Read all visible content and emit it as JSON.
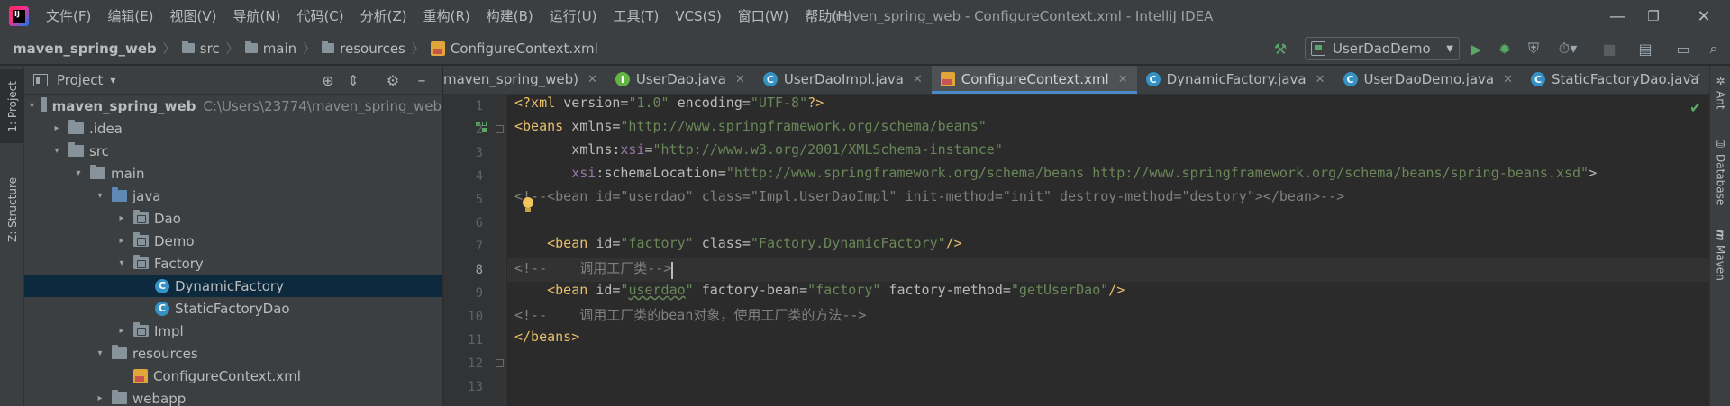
{
  "window": {
    "title": "maven_spring_web - ConfigureContext.xml - IntelliJ IDEA",
    "logo_text": "IJ",
    "controls": [
      "—",
      "❐",
      "✕"
    ]
  },
  "menu": [
    "文件(F)",
    "编辑(E)",
    "视图(V)",
    "导航(N)",
    "代码(C)",
    "分析(Z)",
    "重构(R)",
    "构建(B)",
    "运行(U)",
    "工具(T)",
    "VCS(S)",
    "窗口(W)",
    "帮助(H)"
  ],
  "breadcrumbs": [
    "maven_spring_web",
    "src",
    "main",
    "resources",
    "ConfigureContext.xml"
  ],
  "toolbar": {
    "run_config": "UserDaoDemo",
    "icons": [
      "hammer-icon",
      "run-icon",
      "debug-icon",
      "coverage-icon",
      "profile-icon",
      "stop-icon",
      "project-structure-icon",
      "layout-icon",
      "search-icon"
    ]
  },
  "left_strip": {
    "project_tab": "1: Project",
    "structure_tab": "Z: Structure"
  },
  "project_panel": {
    "title": "Project",
    "caret": "▾",
    "tree": [
      {
        "label": "maven_spring_web",
        "path": "C:\\Users\\23774\\maven_spring_web",
        "icon": "folder",
        "arrow": "▾",
        "depth": 0,
        "bold": true
      },
      {
        "label": ".idea",
        "icon": "folder",
        "arrow": "▸",
        "depth": 1
      },
      {
        "label": "src",
        "icon": "folder",
        "arrow": "▾",
        "depth": 1
      },
      {
        "label": "main",
        "icon": "folder",
        "arrow": "▾",
        "depth": 2
      },
      {
        "label": "java",
        "icon": "folder-blue",
        "arrow": "▾",
        "depth": 3
      },
      {
        "label": "Dao",
        "icon": "package",
        "arrow": "▸",
        "depth": 4
      },
      {
        "label": "Demo",
        "icon": "package",
        "arrow": "▸",
        "depth": 4
      },
      {
        "label": "Factory",
        "icon": "package",
        "arrow": "▾",
        "depth": 4
      },
      {
        "label": "DynamicFactory",
        "icon": "class",
        "arrow": "",
        "depth": 5,
        "selected": true
      },
      {
        "label": "StaticFactoryDao",
        "icon": "class",
        "arrow": "",
        "depth": 5
      },
      {
        "label": "Impl",
        "icon": "package",
        "arrow": "▸",
        "depth": 4
      },
      {
        "label": "resources",
        "icon": "folder-res",
        "arrow": "▾",
        "depth": 3
      },
      {
        "label": "ConfigureContext.xml",
        "icon": "xml",
        "arrow": "",
        "depth": 4
      },
      {
        "label": "webapp",
        "icon": "folder",
        "arrow": "▸",
        "depth": 3
      }
    ]
  },
  "tabs": [
    {
      "label": "maven_spring_web)",
      "icon": "none"
    },
    {
      "label": "UserDao.java",
      "icon": "interface"
    },
    {
      "label": "UserDaoImpl.java",
      "icon": "class"
    },
    {
      "label": "ConfigureContext.xml",
      "icon": "xml",
      "active": true
    },
    {
      "label": "DynamicFactory.java",
      "icon": "class"
    },
    {
      "label": "UserDaoDemo.java",
      "icon": "class"
    },
    {
      "label": "StaticFactoryDao.java",
      "icon": "class"
    }
  ],
  "editor": {
    "current_line": 8,
    "lines": [
      {
        "n": "1",
        "tokens": [
          [
            "t-pi",
            "<?xml "
          ],
          [
            "t-attr",
            "version="
          ],
          [
            "t-val",
            "\"1.0\""
          ],
          [
            "t-attr",
            " encoding="
          ],
          [
            "t-val",
            "\"UTF-8\""
          ],
          [
            "t-pi",
            "?>"
          ]
        ]
      },
      {
        "n": "2",
        "tokens": [
          [
            "t-tag",
            "<beans "
          ],
          [
            "t-attr",
            "xmlns="
          ],
          [
            "t-val",
            "\"http://www.springframework.org/schema/beans\""
          ]
        ]
      },
      {
        "n": "3",
        "tokens": [
          [
            "t-attr",
            "       xmlns:"
          ],
          [
            "t-ns",
            "xsi"
          ],
          [
            "t-attr",
            "="
          ],
          [
            "t-val",
            "\"http://www.w3.org/2001/XMLSchema-instance\""
          ]
        ]
      },
      {
        "n": "4",
        "tokens": [
          [
            "t-ns",
            "       xsi"
          ],
          [
            "t-attr",
            ":schemaLocation="
          ],
          [
            "t-val",
            "\"http://www.springframework.org/schema/beans http://www.springframework.org/schema/beans/spring-beans.xsd\""
          ],
          [
            "t-attr",
            ">"
          ]
        ]
      },
      {
        "n": "5",
        "tokens": [
          [
            "t-cmt",
            "<!--<bean id=\"userdao\" class=\"Impl.UserDaoImpl\" init-method=\"init\" destroy-method=\"destory\"></bean>-->"
          ]
        ]
      },
      {
        "n": "6",
        "tokens": []
      },
      {
        "n": "7",
        "tokens": [
          [
            "t-tag",
            "    <bean "
          ],
          [
            "t-attr",
            "id="
          ],
          [
            "t-val",
            "\"factory\""
          ],
          [
            "t-attr",
            " class="
          ],
          [
            "t-val",
            "\"Factory.DynamicFactory\""
          ],
          [
            "t-tag",
            "/>"
          ]
        ]
      },
      {
        "n": "8",
        "tokens": [
          [
            "t-cmt",
            "<!--    调用工厂类-->"
          ]
        ]
      },
      {
        "n": "9",
        "tokens": [
          [
            "t-tag",
            "    <bean "
          ],
          [
            "t-attr",
            "id="
          ],
          [
            "t-val",
            "\""
          ],
          [
            "t-val under",
            "userdao"
          ],
          [
            "t-val",
            "\""
          ],
          [
            "t-attr",
            " factory-bean="
          ],
          [
            "t-val",
            "\"factory\""
          ],
          [
            "t-attr",
            " factory-method="
          ],
          [
            "t-val",
            "\"getUserDao\""
          ],
          [
            "t-tag",
            "/>"
          ]
        ]
      },
      {
        "n": "10",
        "tokens": [
          [
            "t-cmt",
            "<!--    调用工厂类的bean对象，使用工厂类的方法-->"
          ]
        ]
      },
      {
        "n": "11",
        "tokens": [
          [
            "t-tag",
            "</beans>"
          ]
        ]
      },
      {
        "n": "12",
        "tokens": []
      },
      {
        "n": "13",
        "tokens": []
      }
    ]
  },
  "right_strip": [
    "Ant",
    "Database",
    "Maven"
  ],
  "colors": {
    "background": "#2b2b2b",
    "panel": "#3c3f41",
    "selection": "#0d293e",
    "accent": "#4a88c7",
    "xml_tag": "#e8bf6a",
    "xml_value": "#6a8759",
    "comment": "#808080"
  }
}
